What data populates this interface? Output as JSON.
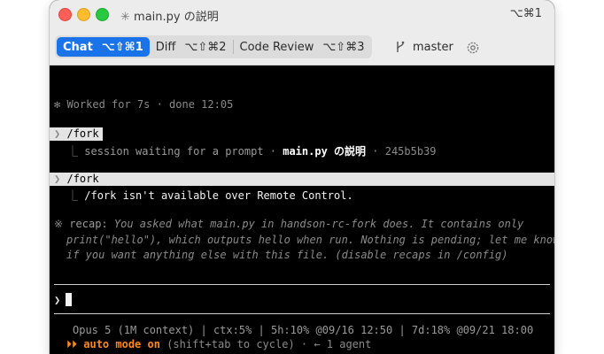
{
  "window": {
    "title_prefix": "✳",
    "title": "main.py の説明",
    "shortcut": "⌥⌘1"
  },
  "tabs": [
    {
      "label": "Chat",
      "kbd": "⌥⇧⌘1",
      "active": true
    },
    {
      "label": "Diff",
      "kbd": "⌥⇧⌘2",
      "active": false
    },
    {
      "label": "Code Review",
      "kbd": "⌥⇧⌘3",
      "active": false
    }
  ],
  "branch": {
    "name": "master"
  },
  "terminal": {
    "worked": "✻ Worked for 7s · done 12:05",
    "fork1": {
      "prompt": "❯",
      "command": "/fork",
      "tree": "⎿",
      "session_text": "session waiting for a prompt ·",
      "session_name": "main.py の説明",
      "session_hash": "· 245b5b39"
    },
    "fork2": {
      "prompt": "❯",
      "command": "/fork",
      "tree": "⎿",
      "message": "/fork isn't available over Remote Control."
    },
    "recap": {
      "bullet": "※",
      "label": "recap:",
      "line1": "You asked what main.py in handson-rc-fork does. It contains only",
      "line2": "print(\"hello\"), which outputs hello when run. Nothing is pending; let me know",
      "line3": "if you want anything else with this file. (disable recaps in /config)"
    },
    "input": {
      "prompt": "❯",
      "value": ""
    },
    "status": "Opus 5 (1M context) | ctx:5% | 5h:10% @09/16 12:50 | 7d:18% @09/21 18:00",
    "mode": {
      "arrows": "⏵⏵",
      "label": "auto mode on",
      "hint": "(shift+tab to cycle) · ← 1 agent"
    }
  },
  "colors": {
    "accent": "#1a73e8",
    "mode": "#ff8a1f",
    "terminal_bg": "#000000"
  }
}
